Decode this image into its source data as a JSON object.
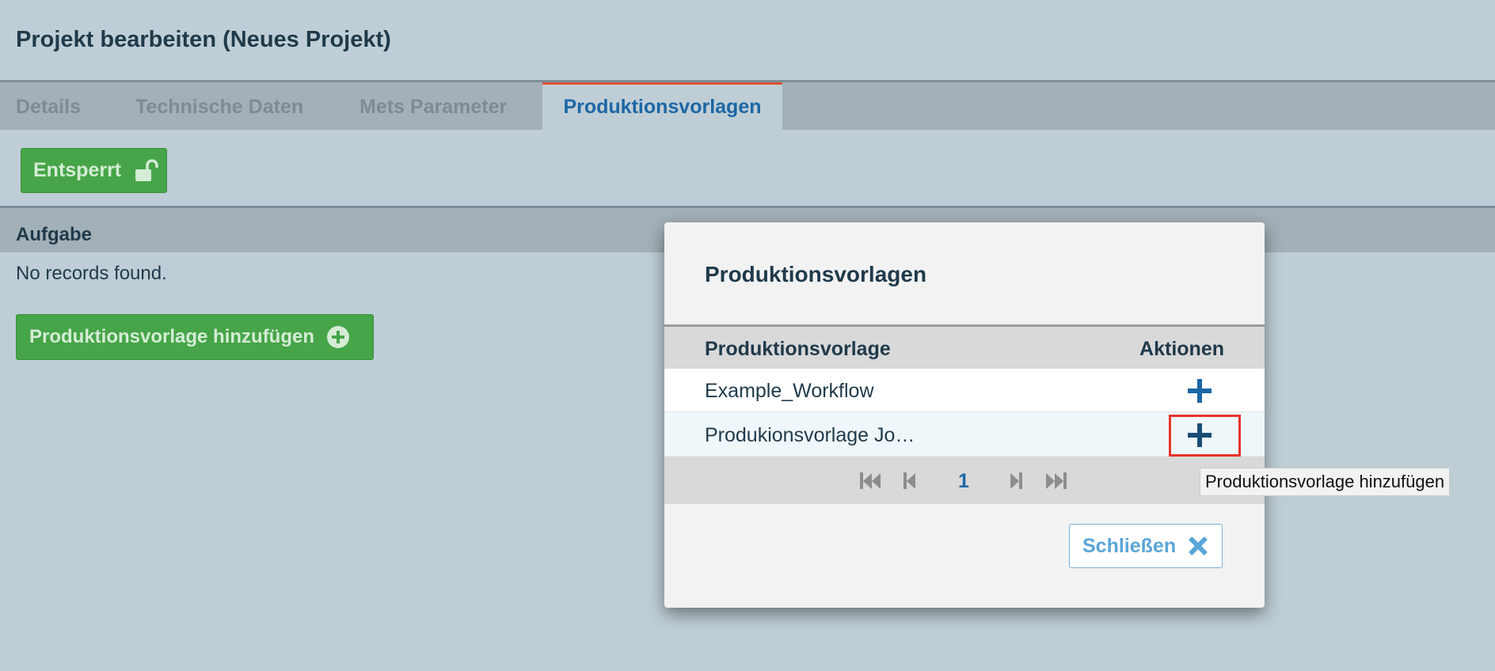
{
  "page": {
    "title": "Projekt bearbeiten (Neues Projekt)"
  },
  "tabs": [
    {
      "label": "Details",
      "active": false
    },
    {
      "label": "Technische Daten",
      "active": false
    },
    {
      "label": "Mets Parameter",
      "active": false
    },
    {
      "label": "Produktionsvorlagen",
      "active": true
    }
  ],
  "lock_button": {
    "label": "Entsperrt",
    "icon": "unlock-icon"
  },
  "section": {
    "title": "Aufgabe",
    "empty_message": "No records found.",
    "add_button_label": "Produktionsvorlage hinzufügen",
    "add_button_icon": "plus-circle-icon"
  },
  "dialog": {
    "title": "Produktionsvorlagen",
    "columns": [
      "Produktionsvorlage",
      "Aktionen"
    ],
    "rows": [
      {
        "name": "Example_Workflow",
        "action_icon": "plus-icon"
      },
      {
        "name": "Produkionsvorlage Jo…",
        "action_icon": "plus-icon"
      }
    ],
    "pagination": {
      "current_page": "1",
      "icons": [
        "first-page-icon",
        "prev-page-icon",
        "next-page-icon",
        "last-page-icon"
      ]
    },
    "close_button_label": "Schließen",
    "close_icon": "close-icon"
  },
  "tooltip": {
    "text": "Produktionsvorlage hinzufügen"
  },
  "colors": {
    "background": "#bfced6",
    "primary_green": "#46a548",
    "accent_blue": "#1b67a6",
    "active_tab_border": "#d9532c",
    "highlight_red": "#e8332a"
  }
}
